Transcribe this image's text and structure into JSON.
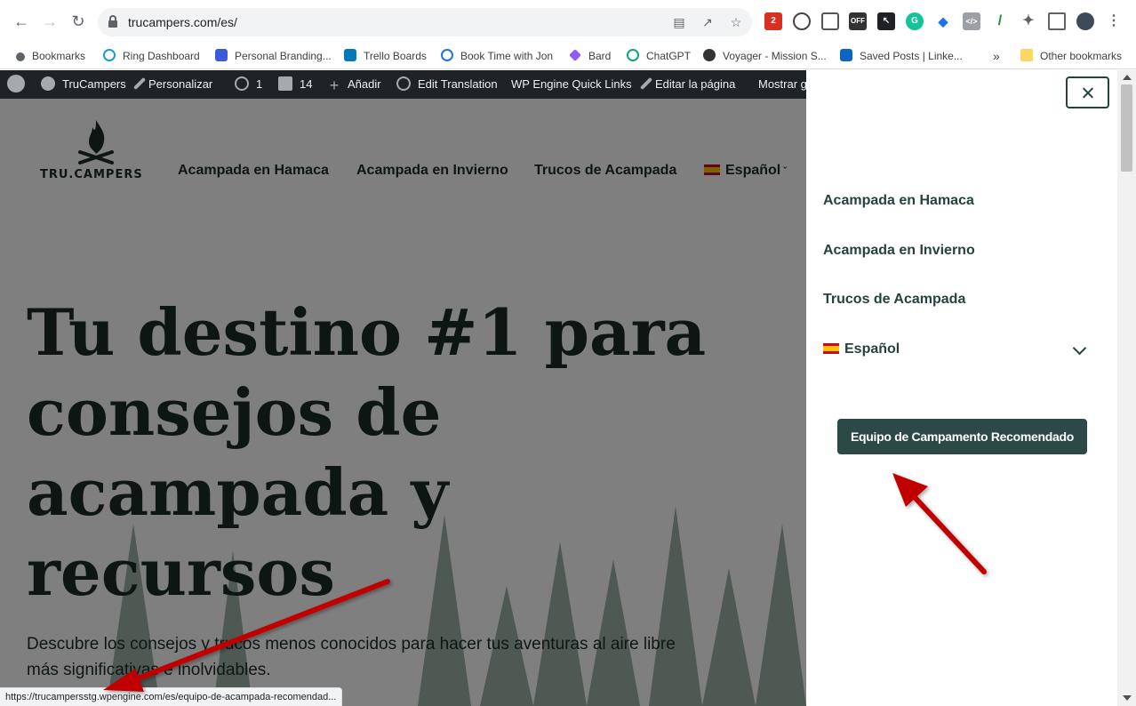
{
  "browser": {
    "url": "trucampers.com/es/",
    "status_url": "https://trucampersstg.wpengine.com/es/equipo-de-acampada-recomendad..."
  },
  "bookmarks": [
    {
      "label": "Bookmarks",
      "icon": "star-icon",
      "color": "#5f6368"
    },
    {
      "label": "Ring Dashboard",
      "icon": "ring-icon",
      "color": "#1c9ad6"
    },
    {
      "label": "Personal Branding...",
      "icon": "branding-icon",
      "color": "#3b5bdb"
    },
    {
      "label": "Trello Boards",
      "icon": "trello-icon",
      "color": "#0079bf"
    },
    {
      "label": "Book Time with Jon",
      "icon": "calendar-icon",
      "color": "#1a73e8"
    },
    {
      "label": "Bard",
      "icon": "bard-icon",
      "color": "#8e5cf7"
    },
    {
      "label": "ChatGPT",
      "icon": "chatgpt-icon",
      "color": "#10a37f"
    },
    {
      "label": "Voyager - Mission S...",
      "icon": "voyager-icon",
      "color": "#333333"
    },
    {
      "label": "Saved Posts | Linke...",
      "icon": "linkedin-icon",
      "color": "#0a66c2"
    }
  ],
  "bookmarks_overflow": "»",
  "other_bookmarks": "Other bookmarks",
  "extension_badge": "2",
  "extension_off_label": "OFF",
  "admin_bar": {
    "site": "TruCampers",
    "customize": "Personalizar",
    "updates": "1",
    "comments": "14",
    "new": "Añadir",
    "edit_translation": "Edit Translation",
    "wp_engine": "WP Engine Quick Links",
    "edit_page": "Editar la página",
    "show": "Mostrar g"
  },
  "site": {
    "logo_text": "TRU.CAMPERS",
    "nav": [
      "Acampada en Hamaca",
      "Acampada en Invierno",
      "Trucos de Acampada",
      "Español"
    ],
    "hero_title_lines": [
      "Tu destino #1 para",
      "consejos de",
      "acampada y",
      "recursos"
    ],
    "hero_sub": "Descubre los consejos y trucos menos conocidos para hacer tus aventuras al aire libre más significativas e inolvidables."
  },
  "menu_panel": {
    "items": [
      "Acampada en Hamaca",
      "Acampada en Invierno",
      "Trucos de Acampada"
    ],
    "language": "Español",
    "cta": "Equipo de Campamento Recomendado"
  },
  "colors": {
    "brand_dark": "#25423e",
    "cta_bg": "#2c4947",
    "admin_bar": "#1d2327",
    "annotation_arrow": "#c00000"
  }
}
